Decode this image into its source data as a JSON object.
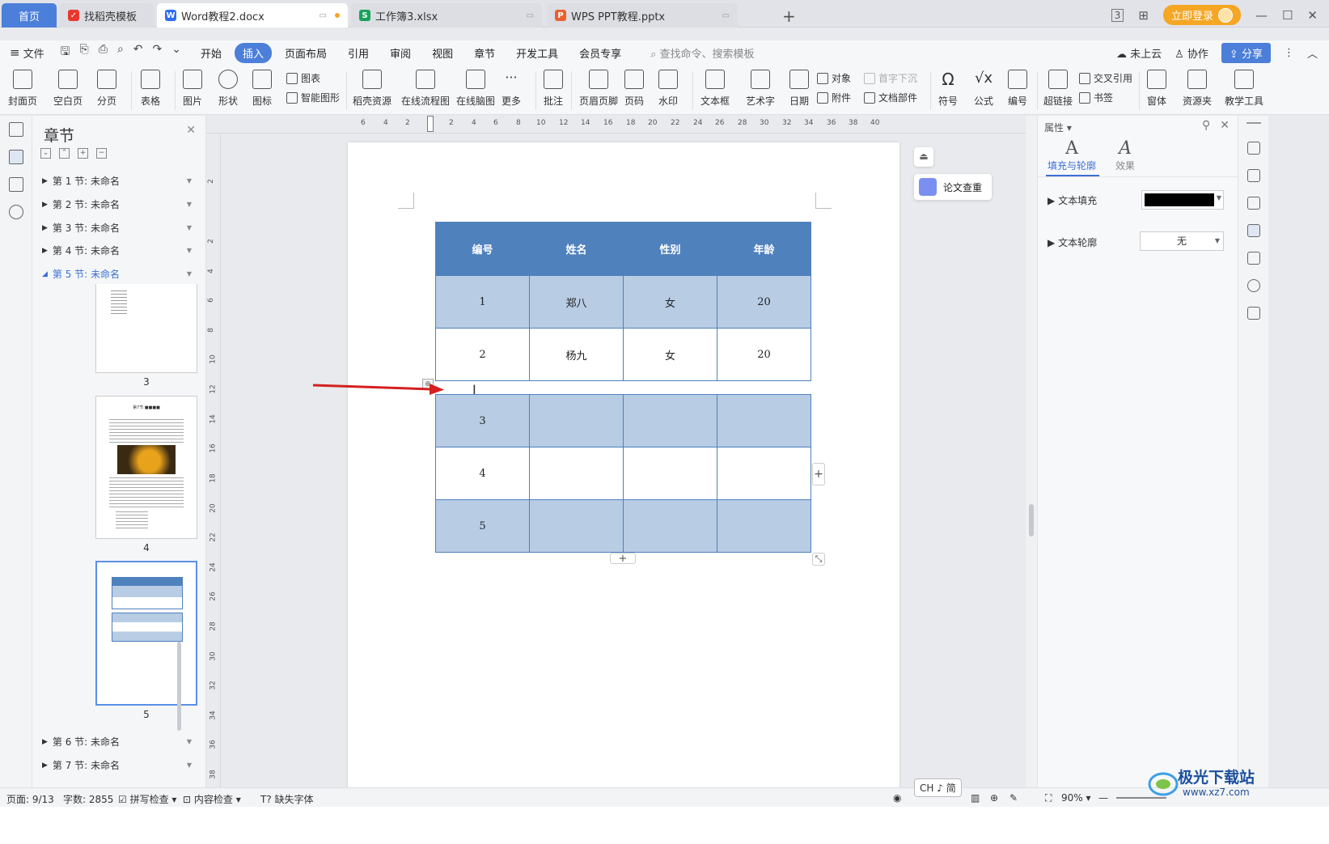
{
  "tabs": {
    "home": "首页",
    "t1": "找稻壳模板",
    "t2": "Word教程2.docx",
    "t3": "工作簿3.xlsx",
    "t4": "WPS PPT教程.pptx"
  },
  "title_bar": {
    "login": "立即登录"
  },
  "menu": {
    "file": "文件",
    "items": [
      "开始",
      "插入",
      "页面布局",
      "引用",
      "审阅",
      "视图",
      "章节",
      "开发工具",
      "会员专享"
    ],
    "search": "查找命令、搜索模板",
    "cloud": "未上云",
    "collab": "协作",
    "share": "分享"
  },
  "ribbon": {
    "cover": "封面页",
    "blank": "空白页",
    "pagebreak": "分页",
    "table": "表格",
    "picture": "图片",
    "shape": "形状",
    "icon": "图标",
    "chart": "图表",
    "smartart": "智能图形",
    "docer": "稻壳资源",
    "flow": "在线流程图",
    "mind": "在线脑图",
    "more": "更多",
    "comment": "批注",
    "header": "页眉页脚",
    "pagenum": "页码",
    "watermark": "水印",
    "textbox": "文本框",
    "arttext": "艺术字",
    "date": "日期",
    "object": "对象",
    "attach": "附件",
    "dropcap": "首字下沉",
    "docpart": "文档部件",
    "symbol": "符号",
    "formula": "公式",
    "numbering": "编号",
    "hyperlink": "超链接",
    "crossref": "交叉引用",
    "bookmark": "书签",
    "window": "窗体",
    "resource": "资源夹",
    "teach": "教学工具"
  },
  "nav": {
    "title": "章节",
    "sections": [
      "第 1 节: 未命名",
      "第 2 节: 未命名",
      "第 3 节: 未命名",
      "第 4 节: 未命名",
      "第 5 节: 未命名",
      "第 6 节: 未命名",
      "第 7 节: 未命名"
    ],
    "thumb_labels": [
      "3",
      "4",
      "5"
    ],
    "thumb4_title": "第7节 ■■■■"
  },
  "ruler": {
    "h": [
      "6",
      "4",
      "2",
      "2",
      "4",
      "6",
      "8",
      "10",
      "12",
      "14",
      "16",
      "18",
      "20",
      "22",
      "24",
      "26",
      "28",
      "30",
      "32",
      "34",
      "36",
      "38",
      "40"
    ],
    "v": [
      "2",
      "2",
      "4",
      "6",
      "8",
      "10",
      "12",
      "14",
      "16",
      "18",
      "20",
      "22",
      "24",
      "26",
      "28",
      "30",
      "32",
      "34",
      "36",
      "38"
    ]
  },
  "table": {
    "headers": [
      "编号",
      "姓名",
      "性别",
      "年龄"
    ],
    "top_rows": [
      [
        "1",
        "郑八",
        "女",
        "20"
      ],
      [
        "2",
        "杨九",
        "女",
        "20"
      ]
    ],
    "bottom_rows": [
      [
        "3",
        "",
        "",
        ""
      ],
      [
        "4",
        "",
        "",
        ""
      ],
      [
        "5",
        "",
        "",
        ""
      ]
    ],
    "colors": {
      "header": "#4f81bd",
      "band": "#b8cce4"
    }
  },
  "side": {
    "lunwen": "论文查重"
  },
  "props": {
    "title": "属性",
    "tab_fill": "填充与轮廓",
    "tab_effect": "效果",
    "text_fill": "文本填充",
    "text_outline": "文本轮廓",
    "outline_value": "无"
  },
  "status": {
    "page": "页面: 9/13",
    "words": "字数: 2855",
    "spell": "拼写检查",
    "content": "内容检查",
    "font": "缺失字体",
    "zoom": "90%",
    "ime": "CH ♪ 简"
  },
  "watermark": {
    "name": "极光下载站",
    "url": "www.xz7.com"
  }
}
